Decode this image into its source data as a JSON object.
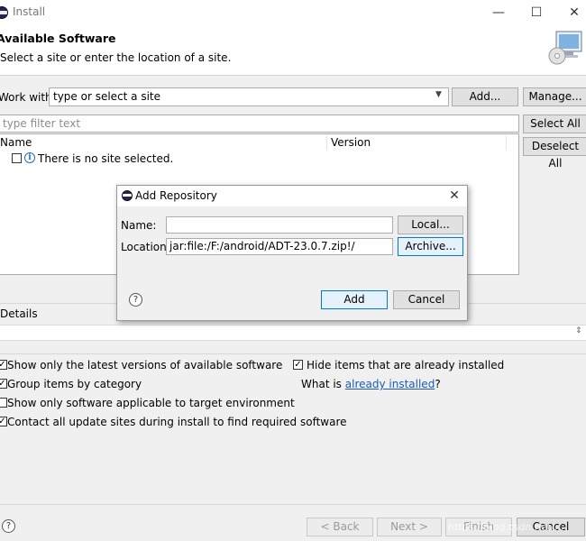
{
  "window": {
    "title": "Install"
  },
  "header": {
    "title": "Available Software",
    "subtitle": "Select a site or enter the location of a site."
  },
  "work_with": {
    "label": "Work with:",
    "value": "type or select a site",
    "add_label": "Add...",
    "manage_label": "Manage..."
  },
  "filter": {
    "placeholder": "type filter text"
  },
  "select_all_label": "Select All",
  "deselect_all_label": "Deselect All",
  "tree": {
    "columns": [
      "Name",
      "Version"
    ],
    "rows": [
      {
        "text": "There is no site selected.",
        "checked": false
      }
    ]
  },
  "details": {
    "label": "Details"
  },
  "options": {
    "latest_versions": {
      "label": "Show only the latest versions of available software",
      "checked": true
    },
    "group_by_category": {
      "label": "Group items by category",
      "checked": true
    },
    "target_env": {
      "label": "Show only software applicable to target environment",
      "checked": false
    },
    "contact_sites": {
      "label": "Contact all update sites during install to find required software",
      "checked": true
    },
    "hide_installed": {
      "label": "Hide items that are already installed",
      "checked": true
    },
    "what_is_prefix": "What is",
    "what_is_link": "already installed",
    "what_is_suffix": "?"
  },
  "footer": {
    "back_label": "< Back",
    "next_label": "Next >",
    "finish_label": "Finish",
    "cancel_label": "Cancel"
  },
  "dialog": {
    "title": "Add Repository",
    "name_label": "Name:",
    "name_value": "",
    "location_label": "Location:",
    "location_value": "jar:file:/F:/android/ADT-23.0.7.zip!/",
    "local_label": "Local...",
    "archive_label": "Archive...",
    "add_label": "Add",
    "cancel_label": "Cancel"
  },
  "watermark": "https://blog.csdn.net/...",
  "colors": {
    "link": "#1a5cb8",
    "focus_border": "#0078d7",
    "accent": "#2c2255"
  }
}
